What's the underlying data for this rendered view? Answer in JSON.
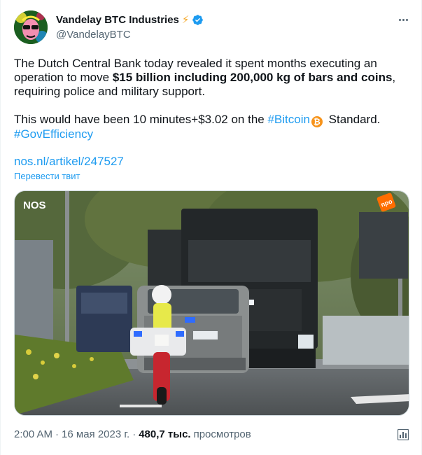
{
  "author": {
    "display_name": "Vandelay BTC Industries",
    "handle": "@VandelayBTC",
    "badge_emoji": "⚡"
  },
  "tweet": {
    "p1_before": "The Dutch Central Bank today revealed it spent months executing an operation to move ",
    "p1_bold": "$15 billion including 200,000 kg of bars and coins",
    "p1_after": ", requiring police and military support.",
    "p2_before": "This would have been 10 minutes+$3.02 on the ",
    "hashtag_bitcoin": "#Bitcoin",
    "bitcoin_symbol": "₿",
    "p2_after": " Standard.",
    "hashtag_gov": "#GovEfficiency",
    "link": "nos.nl/artikel/247527",
    "translate_label": "Перевести твит"
  },
  "media": {
    "logo_text": "NOS",
    "corner_badge_text": "npo"
  },
  "meta": {
    "time": "2:00 AM",
    "separator": "·",
    "date": "16 мая 2023 г.",
    "views_count": "480,7 тыс.",
    "views_label": "просмотров"
  },
  "colors": {
    "link": "#1d9bf0",
    "muted": "#536471",
    "verified": "#1d9bf0",
    "bitcoin": "#f7931a"
  },
  "icons": {
    "more": "more-horizontal-icon",
    "verified": "verified-badge-icon",
    "analytics": "analytics-icon"
  }
}
